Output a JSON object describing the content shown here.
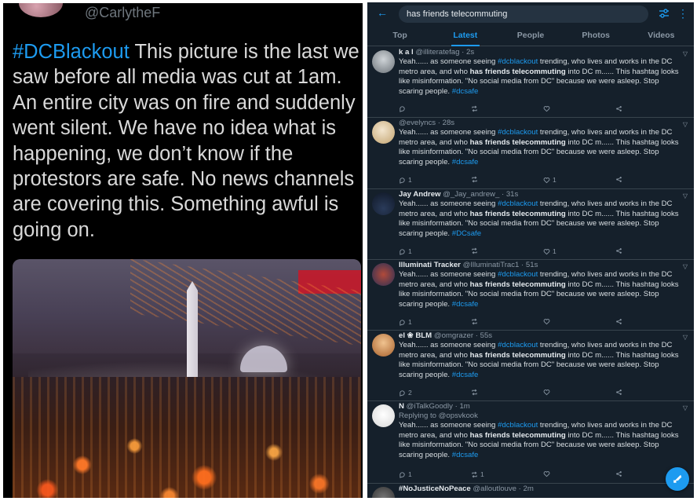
{
  "left_post": {
    "handle": "@CarlytheF",
    "hashtag": "#DCBlackout",
    "text": " This picture is the last we saw before all media was cut at 1am. An entire city was on fire and suddenly went silent. We have no idea what is happening, we don’t know if the protestors are safe. No news channels are covering this. Something awful is going on."
  },
  "search": {
    "back_icon": "back-arrow-icon",
    "query": "has friends telecommuting",
    "filter_icon": "sliders-icon",
    "more_icon": "more-vertical-icon"
  },
  "tabs": [
    "Top",
    "Latest",
    "People",
    "Photos",
    "Videos"
  ],
  "active_tab": "Latest",
  "tweet_text": {
    "p1": "Yeah...... as someone seeing ",
    "tag1": "#dcblackout",
    "p2": " trending, who lives and works in the DC metro area, and who ",
    "bold": "has friends telecommuting",
    "p3": " into DC m...... This hashtag looks like misinformation. \"No social media from DC\" because we were asleep. Stop scaring people. "
  },
  "tweets": [
    {
      "name": "k a l",
      "handle": "@illiteratefag",
      "time": "· 2s",
      "reply": "",
      "tag2": "#dcsafe",
      "replies": "",
      "retweets": "",
      "likes": ""
    },
    {
      "name": "",
      "handle": "@evelyncs",
      "time": "· 28s",
      "reply": "",
      "tag2": "#dcsafe",
      "replies": "1",
      "retweets": "",
      "likes": "1"
    },
    {
      "name": "Jay Andrew",
      "handle": "@_Jay_andrew_",
      "time": "· 31s",
      "reply": "",
      "tag2": "#DCsafe",
      "replies": "1",
      "retweets": "",
      "likes": "1"
    },
    {
      "name": "Illuminati Tracker",
      "handle": "@IlluminatiTrac1",
      "time": "· 51s",
      "reply": "",
      "tag2": "#dcsafe",
      "replies": "1",
      "retweets": "",
      "likes": ""
    },
    {
      "name": "el ❀ BLM",
      "handle": "@omgrazer",
      "time": "· 55s",
      "reply": "",
      "tag2": "#dcsafe",
      "replies": "2",
      "retweets": "",
      "likes": ""
    },
    {
      "name": "N",
      "handle": "@iTalkGoodly",
      "time": "· 1m",
      "reply": "Replying to @opsvkook",
      "tag2": "#dcsafe",
      "replies": "1",
      "retweets": "1",
      "likes": ""
    }
  ],
  "last_tweet": {
    "name": "#NoJusticeNoPeace",
    "handle": "@alloutlouve",
    "time": "· 2m"
  },
  "colors": {
    "accent": "#1d9bf0",
    "background": "#15202b",
    "divider": "#38444d"
  }
}
